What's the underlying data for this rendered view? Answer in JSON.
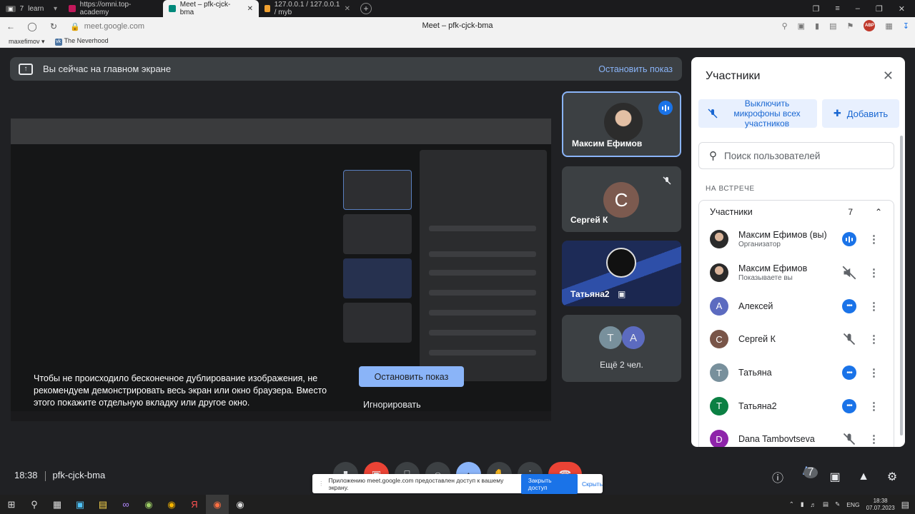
{
  "browser": {
    "tabs": [
      {
        "label": "7",
        "sub": "learn"
      },
      {
        "label": "https://omni.top-academy"
      },
      {
        "label": "Meet – pfk-cjck-bma"
      },
      {
        "label": "127.0.0.1 / 127.0.0.1 / myb"
      }
    ],
    "url": "meet.google.com",
    "page_title": "Meet – pfk-cjck-bma",
    "abp": "ABP",
    "bookmarks": [
      "maxefimov",
      "The Neverhood"
    ]
  },
  "meet": {
    "banner_text": "Вы сейчас на главном экране",
    "banner_stop": "Остановить показ",
    "info_text": "Чтобы не происходило бесконечное дублирование изображения, не рекомендуем демонстрировать весь экран или окно браузера. Вместо этого покажите отдельную вкладку или другое окно.",
    "stop_button": "Остановить показ",
    "ignore_button": "Игнорировать",
    "tiles": [
      {
        "name": "Максим Ефимов"
      },
      {
        "name": "Сергей К",
        "initial": "С"
      },
      {
        "name": "Татьяна2"
      },
      {
        "name": "Ещё 2 чел.",
        "initials": [
          "Т",
          "А"
        ]
      }
    ],
    "time": "18:38",
    "meeting_code": "pfk-cjck-bma",
    "participants_badge": "7",
    "share_notice": "Приложению meet.google.com предоставлен доступ к вашему экрану.",
    "share_close": "Закрыть доступ",
    "share_hide": "Скрыть"
  },
  "panel": {
    "title": "Участники",
    "mute_all": "Выключить микрофоны всех участников",
    "add": "Добавить",
    "search_placeholder": "Поиск пользователей",
    "section": "НА ВСТРЕЧЕ",
    "group_label": "Участники",
    "group_count": "7",
    "people": [
      {
        "name": "Максим Ефимов (вы)",
        "role": "Организатор",
        "state": "speaking"
      },
      {
        "name": "Максим Ефимов",
        "role": "Показываете вы",
        "state": "audio-off"
      },
      {
        "name": "Алексей",
        "initial": "А",
        "color": "#5c6bc0",
        "state": "dots"
      },
      {
        "name": "Сергей К",
        "initial": "С",
        "color": "#795548",
        "state": "muted"
      },
      {
        "name": "Татьяна",
        "initial": "Т",
        "color": "#78909c",
        "state": "dots"
      },
      {
        "name": "Татьяна2",
        "initial": "Т",
        "color": "#0b8043",
        "state": "dots"
      },
      {
        "name": "Dana Tambovtseva",
        "initial": "D",
        "color": "#8e24aa",
        "state": "muted"
      }
    ]
  },
  "taskbar": {
    "lang": "ENG",
    "clock_time": "18:38",
    "clock_date": "07.07.2023"
  }
}
